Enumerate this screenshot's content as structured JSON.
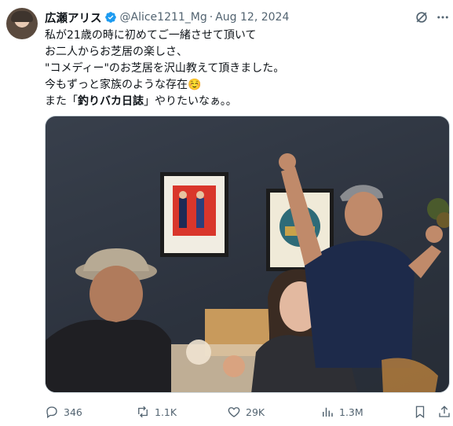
{
  "tweet": {
    "author_name": "広瀬アリス",
    "handle": "@Alice1211_Mg",
    "separator": "·",
    "date": "Aug 12, 2024",
    "lines": [
      "私が21歳の時に初めてご一緒させて頂いて",
      "お二人からお芝居の楽しさ、",
      "\"コメディー\"のお芝居を沢山教えて頂きました。",
      "今もずっと家族のような存在☺️",
      "また「",
      "釣りバカ日誌",
      "」やりたいなぁ。。"
    ]
  },
  "actions": {
    "replies": "346",
    "reposts": "1.1K",
    "likes": "29K",
    "views": "1.3M"
  },
  "colors": {
    "text": "#0f1419",
    "muted": "#536471",
    "verified": "#1d9bf0"
  }
}
